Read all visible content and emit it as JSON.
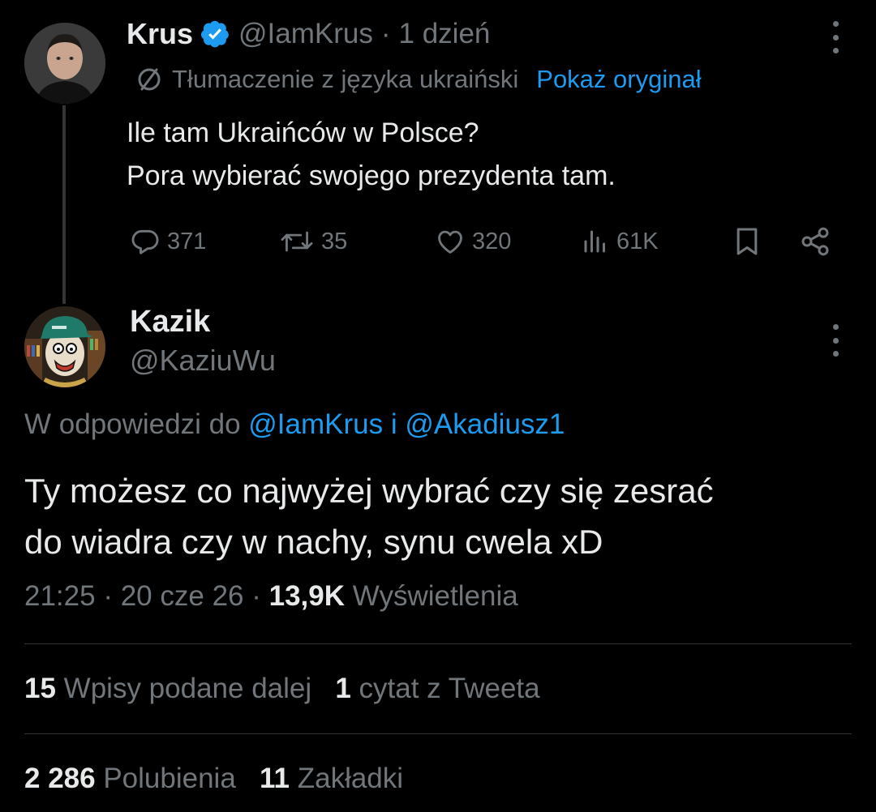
{
  "parent_tweet": {
    "display_name": "Krus",
    "handle": "@IamKrus",
    "separator": "·",
    "time": "1 dzień",
    "translation_label": "Tłumaczenie z języka ukraiński",
    "show_original_label": "Pokaż oryginał",
    "text_lines": [
      "Ile tam Ukraińców w Polsce?",
      "Pora wybierać swojego prezydenta tam."
    ],
    "actions": {
      "replies": "371",
      "retweets": "35",
      "likes": "320",
      "views": "61K"
    },
    "verified_color": "#1d9bf0"
  },
  "reply_tweet": {
    "display_name": "Kazik",
    "handle": "@KaziuWu",
    "context_prefix": "W odpowiedzi do",
    "context_mention_1": "@IamKrus",
    "context_join": "i",
    "context_mention_2": "@Akadiusz1",
    "text_lines": [
      "Ty możesz co najwyżej wybrać czy się zesrać",
      "do wiadra czy w nachy, synu cwela xD"
    ],
    "time": "21:25",
    "date": "20 cze 26",
    "separator": "·",
    "views_count": "13,9K",
    "views_label": "Wyświetlenia"
  },
  "stats": {
    "reposts_count": "15",
    "reposts_label": "Wpisy podane dalej",
    "quotes_count": "1",
    "quotes_label": "cytat z Tweeta",
    "likes_count": "2 286",
    "likes_label": "Polubienia",
    "bookmarks_count": "11",
    "bookmarks_label": "Zakładki"
  },
  "icons": {
    "verified": "verified-badge-icon",
    "more": "more-options-icon",
    "translate": "translate-icon",
    "reply": "reply-icon",
    "retweet": "retweet-icon",
    "like": "heart-icon",
    "views": "views-chart-icon",
    "bookmark": "bookmark-icon",
    "share": "share-icon"
  },
  "colors": {
    "background": "#000000",
    "text_primary": "#e7e9ea",
    "text_secondary": "#71767b",
    "accent": "#1d9bf0",
    "divider": "#2f3336"
  }
}
